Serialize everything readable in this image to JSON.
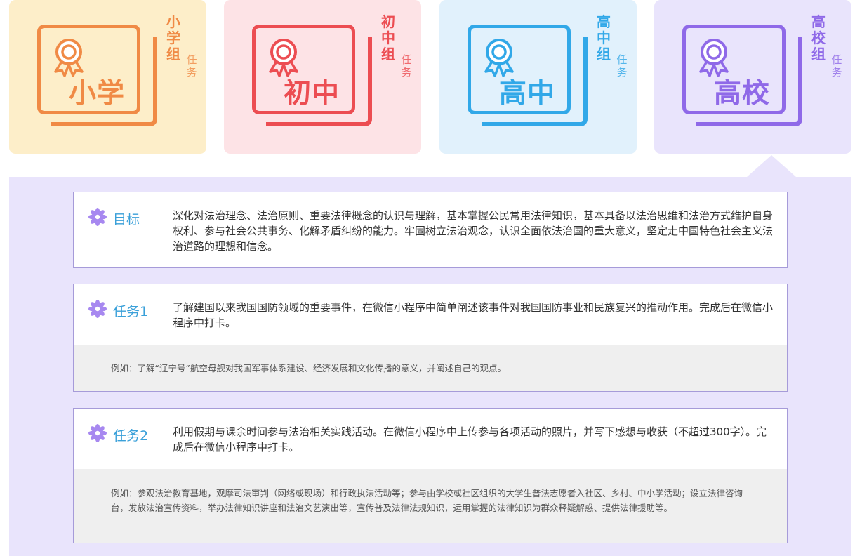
{
  "tabs": [
    {
      "id": "primary",
      "big_label": "小学",
      "title": "小学组",
      "subtitle": "任务",
      "color": "#f08a45",
      "bg": "#fdeec9"
    },
    {
      "id": "junior",
      "big_label": "初中",
      "title": "初中组",
      "subtitle": "任务",
      "color": "#ec4d52",
      "bg": "#fde3e6"
    },
    {
      "id": "senior",
      "big_label": "高中",
      "title": "高中组",
      "subtitle": "任务",
      "color": "#31a8e8",
      "bg": "#e1f1fc"
    },
    {
      "id": "college",
      "big_label": "高校",
      "title": "高校组",
      "subtitle": "任务",
      "color": "#8f69e8",
      "bg": "#e9e4fc",
      "selected": true
    }
  ],
  "content": {
    "goal": {
      "icon": "flower-icon",
      "label": "目标",
      "text": "深化对法治理念、法治原则、重要法律概念的认识与理解，基本掌握公民常用法律知识，基本具备以法治思维和法治方式维护自身权利、参与社会公共事务、化解矛盾纠纷的能力。牢固树立法治观念，认识全面依法治国的重大意义，坚定走中国特色社会主义法治道路的理想和信念。"
    },
    "task1": {
      "icon": "flower-icon",
      "label": "任务1",
      "text": "了解建国以来我国国防领域的重要事件，在微信小程序中简单阐述该事件对我国国防事业和民族复兴的推动作用。完成后在微信小程序中打卡。",
      "example": "例如：了解“辽宁号”航空母舰对我国军事体系建设、经济发展和文化传播的意义，并阐述自己的观点。"
    },
    "task2": {
      "icon": "flower-icon",
      "label": "任务2",
      "text": "利用假期与课余时间参与法治相关实践活动。在微信小程序中上传参与各项活动的照片，并写下感想与收获（不超过300字）。完成后在微信小程序中打卡。",
      "example": "例如：参观法治教育基地，观摩司法审判（网络或现场）和行政执法活动等；参与由学校或社区组织的大学生普法志愿者入社区、乡村、中小学活动；设立法律咨询台，发放法治宣传资料，举办法律知识讲座和法治文艺演出等，宣传普及法律法规知识，运用掌握的法律知识为群众释疑解惑、提供法律援助等。"
    }
  }
}
